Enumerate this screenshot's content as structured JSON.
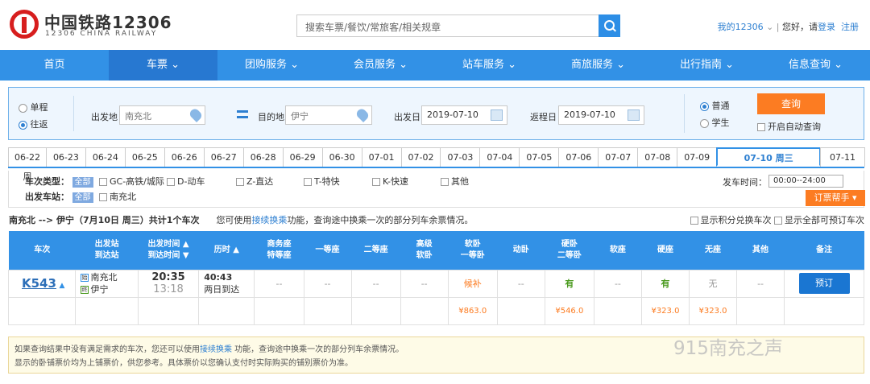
{
  "header": {
    "logo_cn": "中国铁路12306",
    "logo_en": "12306 CHINA RAILWAY",
    "search_placeholder": "搜索车票/餐饮/常旅客/相关规章",
    "my12306": "我的12306",
    "greeting": "您好，请",
    "login": "登录",
    "register": "注册"
  },
  "nav": [
    "首页",
    "车票 ⌄",
    "团购服务 ⌄",
    "会员服务 ⌄",
    "站车服务 ⌄",
    "商旅服务 ⌄",
    "出行指南 ⌄",
    "信息查询 ⌄"
  ],
  "query": {
    "single": "单程",
    "round": "往返",
    "from_label": "出发地",
    "from": "南充北",
    "to_label": "目的地",
    "to": "伊宁",
    "depart_label": "出发日",
    "depart": "2019-07-10",
    "return_label": "返程日",
    "return": "2019-07-10",
    "normal": "普通",
    "student": "学生",
    "query_btn": "查询",
    "auto_query": "开启自动查询"
  },
  "dates": [
    "06-22 周",
    "06-23",
    "06-24",
    "06-25",
    "06-26",
    "06-27",
    "06-28",
    "06-29",
    "06-30",
    "07-01",
    "07-02",
    "07-03",
    "07-04",
    "07-05",
    "07-06",
    "07-07",
    "07-08",
    "07-09",
    "07-10 周三",
    "07-11"
  ],
  "filter": {
    "type_label": "车次类型：",
    "all": "全部",
    "types": [
      "GC-高铁/城际",
      "D-动车",
      "Z-直达",
      "T-特快",
      "K-快速",
      "其他"
    ],
    "station_label": "出发车站：",
    "station": "南充北",
    "time_label": "发车时间：",
    "time": "00:00--24:00",
    "help": "订票帮手 ▾"
  },
  "route": {
    "text": "南充北 --> 伊宁（7月10日 周三）共计1个车次",
    "hint1": "您可使用",
    "link": "接续换乘",
    "hint2": "功能，查询途中换乘一次的部分列车余票情况。",
    "opt1": "显示积分兑换车次",
    "opt2": "显示全部可预订车次"
  },
  "table": {
    "headers": [
      "车次",
      "出发站\n到达站",
      "出发时间 ▲\n到达时间 ▼",
      "历时 ▲",
      "商务座\n特等座",
      "一等座",
      "二等座",
      "高级\n软卧",
      "软卧\n一等卧",
      "动卧",
      "硬卧\n二等卧",
      "软座",
      "硬座",
      "无座",
      "其他",
      "备注"
    ],
    "train": {
      "no": "K543",
      "from": "南充北",
      "to": "伊宁",
      "dep": "20:35",
      "arr": "13:18",
      "dur": "40:43",
      "dur_note": "两日到达",
      "from_ic": "始",
      "to_ic": "终",
      "seats": [
        "--",
        "--",
        "--",
        "--",
        "候补",
        "--",
        "有",
        "--",
        "有",
        "无",
        "--"
      ],
      "book": "预订",
      "prices": [
        "",
        "",
        "",
        "",
        "¥863.0",
        "",
        "¥546.0",
        "",
        "¥323.0",
        "¥323.0",
        ""
      ]
    }
  },
  "notice": {
    "l1a": "如果查询结果中没有满足需求的车次，您还可以使用",
    "link": "接续换乘",
    "l1b": " 功能，查询途中换乘一次的部分列车余票情况。",
    "l2": "显示的卧铺票价均为上铺票价，供您参考。具体票价以您确认支付时实际购买的铺别票价为准。"
  },
  "watermark": "915南充之声"
}
